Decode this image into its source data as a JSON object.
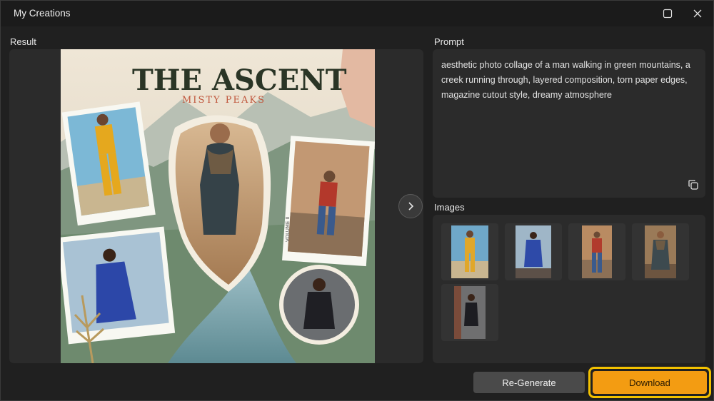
{
  "window": {
    "title": "My Creations",
    "maximize_icon": "maximize-icon",
    "close_icon": "close-icon"
  },
  "result": {
    "label": "Result",
    "poster": {
      "title": "THE ASCENT",
      "subtitle": "MISTY PEAKS",
      "side_text": "VOLUME II"
    },
    "next_icon": "chevron-right-icon"
  },
  "prompt": {
    "label": "Prompt",
    "text": "aesthetic photo collage of a man walking in green mountains, a creek running through, layered composition, torn paper edges, magazine cutout style, dreamy atmosphere",
    "copy_icon": "copy-icon"
  },
  "images": {
    "label": "Images",
    "items": [
      {
        "name": "woman-yellow-tracksuit",
        "bg": "#6fa8c9",
        "fig": "#e0a72a"
      },
      {
        "name": "man-blue-suit",
        "bg": "#9fb6c7",
        "fig": "#2e4aa8"
      },
      {
        "name": "man-plaid-shirt",
        "bg": "#b98b62",
        "fig": "#b13b2c"
      },
      {
        "name": "man-scarf-desert",
        "bg": "#9a7a58",
        "fig": "#3d4a4f"
      },
      {
        "name": "woman-black-dress",
        "bg": "#6f6f70",
        "fig": "#1d1d22"
      }
    ]
  },
  "actions": {
    "regenerate_label": "Re-Generate",
    "download_label": "Download"
  },
  "colors": {
    "accent": "#f39c12",
    "highlight": "#f2c100"
  }
}
